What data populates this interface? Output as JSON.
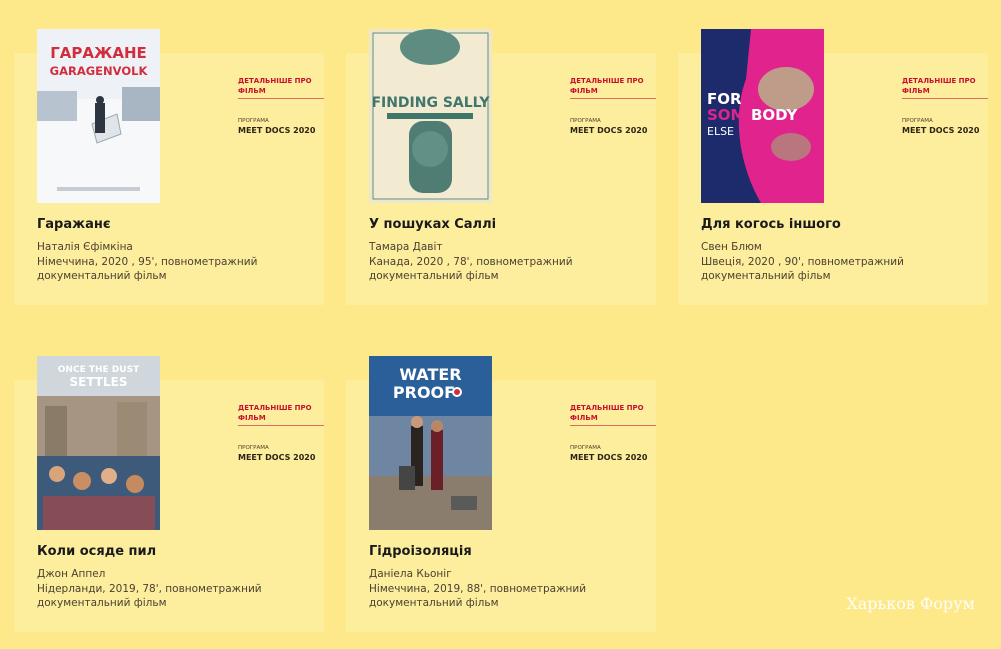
{
  "films": [
    {
      "title": "Гаражанє",
      "more_label": "ДЕТАЛЬНІШЕ ПРО ФІЛЬМ",
      "program_label": "ПРОГРАМА",
      "program_value": "MEET DOCS 2020",
      "director": "Наталія Єфімкіна",
      "meta": "Німеччина, 2020 , 95', повнометражний документальний фільм",
      "poster": {
        "heading": "ГАРАЖАНЕ",
        "subheading": "GARAGENVOLK"
      }
    },
    {
      "title": "У пошуках Саллі",
      "more_label": "ДЕТАЛЬНІШЕ ПРО ФІЛЬМ",
      "program_label": "ПРОГРАМА",
      "program_value": "MEET DOCS 2020",
      "director": "Тамара Давіт",
      "meta": "Канада, 2020 , 78', повнометражний документальний фільм",
      "poster": {
        "heading": "FINDING SALLY"
      }
    },
    {
      "title": "Для когось іншого",
      "more_label": "ДЕТАЛЬНІШЕ ПРО ФІЛЬМ",
      "program_label": "ПРОГРАМА",
      "program_value": "MEET DOCS 2020",
      "director": "Свен Блюм",
      "meta": "Швеція, 2020 , 90', повнометражний документальний фільм",
      "poster": {
        "line1": "FOR",
        "line2a": "SOME",
        "line2b": "BODY",
        "line3": "ELSE"
      }
    },
    {
      "title": "Коли осяде пил",
      "more_label": "ДЕТАЛЬНІШЕ ПРО ФІЛЬМ",
      "program_label": "ПРОГРАМА",
      "program_value": "MEET DOCS 2020",
      "director": "Джон Аппел",
      "meta": "Нідерланди, 2019, 78', повнометражний документальний фільм",
      "poster": {
        "line1": "ONCE THE DUST",
        "line2": "SETTLES"
      }
    },
    {
      "title": "Гідроізоляція",
      "more_label": "ДЕТАЛЬНІШЕ ПРО ФІЛЬМ",
      "program_label": "ПРОГРАМА",
      "program_value": "MEET DOCS 2020",
      "director": "Даніела Кьоніг",
      "meta": "Німеччина, 2019, 88', повнометражний документальний фільм",
      "poster": {
        "line1": "WATER",
        "line2": "PROOF"
      }
    }
  ],
  "watermark": "Харьков Форум",
  "colors": {
    "page_bg": "#fde989",
    "card_bg": "#fdee9e",
    "link_red": "#c8102e"
  }
}
